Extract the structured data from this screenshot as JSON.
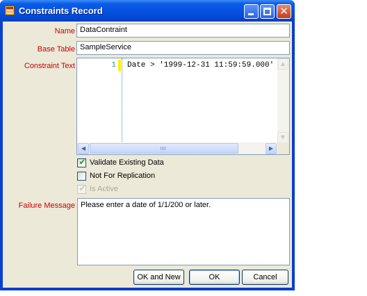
{
  "window": {
    "title": "Constraints Record",
    "app_icon": "table-form-icon",
    "controls": {
      "minimize_icon": "minimize-icon",
      "maximize_icon": "maximize-icon",
      "close_icon": "close-icon",
      "close_glyph": "✕"
    }
  },
  "form": {
    "name_label": "Name",
    "name_value": "DataContraint",
    "base_table_label": "Base Table",
    "base_table_value": "SampleService",
    "constraint_text_label": "Constraint Text",
    "editor": {
      "line_number": "1",
      "code": "Date > '1999-12-31 11:59:59.000'",
      "scroll_up": "▲",
      "scroll_down": "▼",
      "scroll_left": "◀",
      "scroll_right": "▶"
    },
    "options": {
      "validate_existing_label": "Validate Existing Data",
      "validate_existing_checked": true,
      "not_for_replication_label": "Not For Replication",
      "not_for_replication_checked": false,
      "is_active_label": "Is Active",
      "is_active_checked": true,
      "is_active_enabled": false,
      "check_glyph": "✔"
    },
    "failure_message_label": "Failure Message",
    "failure_message_value": "Please enter a date of 1/1/200 or later."
  },
  "buttons": {
    "ok_and_new": "OK and New",
    "ok": "OK",
    "cancel": "Cancel"
  },
  "colors": {
    "label_red": "#cc0000",
    "titlebar_blue": "#0452e0",
    "line_number_teal": "#2b91af",
    "change_marker_yellow": "#ffee00"
  }
}
